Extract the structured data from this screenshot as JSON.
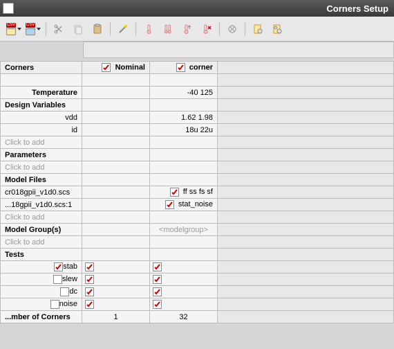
{
  "window": {
    "title": "Corners Setup"
  },
  "toolbar": {
    "icons": [
      "csv-open",
      "csv-save",
      "scissors",
      "copy",
      "paste",
      "wand",
      "thermo-add",
      "thermo-multi",
      "thermo-up",
      "thermo-del",
      "variable",
      "gear-doc",
      "gear-doc2"
    ]
  },
  "columns": {
    "header_label": "Corners",
    "nominal": "Nominal",
    "corner": "corner"
  },
  "rows": {
    "temperature_label": "Temperature",
    "temperature_corner": "-40 125",
    "design_vars_label": "Design Variables",
    "vdd_label": "vdd",
    "vdd_corner": "1.62 1.98",
    "id_label": "id",
    "id_corner": "18u 22u",
    "click_add": "Click to add",
    "params_label": "Parameters",
    "model_files_label": "Model Files",
    "mf1_label": "cr018gpii_v1d0.scs",
    "mf1_corner": "ff ss fs sf",
    "mf2_label": "...18gpii_v1d0.scs:1",
    "mf2_corner": "stat_noise",
    "model_groups_label": "Model Group(s)",
    "model_groups_ph": "<modelgroup>",
    "tests_label": "Tests",
    "test_stab": "stab",
    "test_slew": "slew",
    "test_dc": "dc",
    "test_noise": "noise",
    "num_corners_label": "...mber of Corners",
    "num_nominal": "1",
    "num_corner": "32"
  }
}
